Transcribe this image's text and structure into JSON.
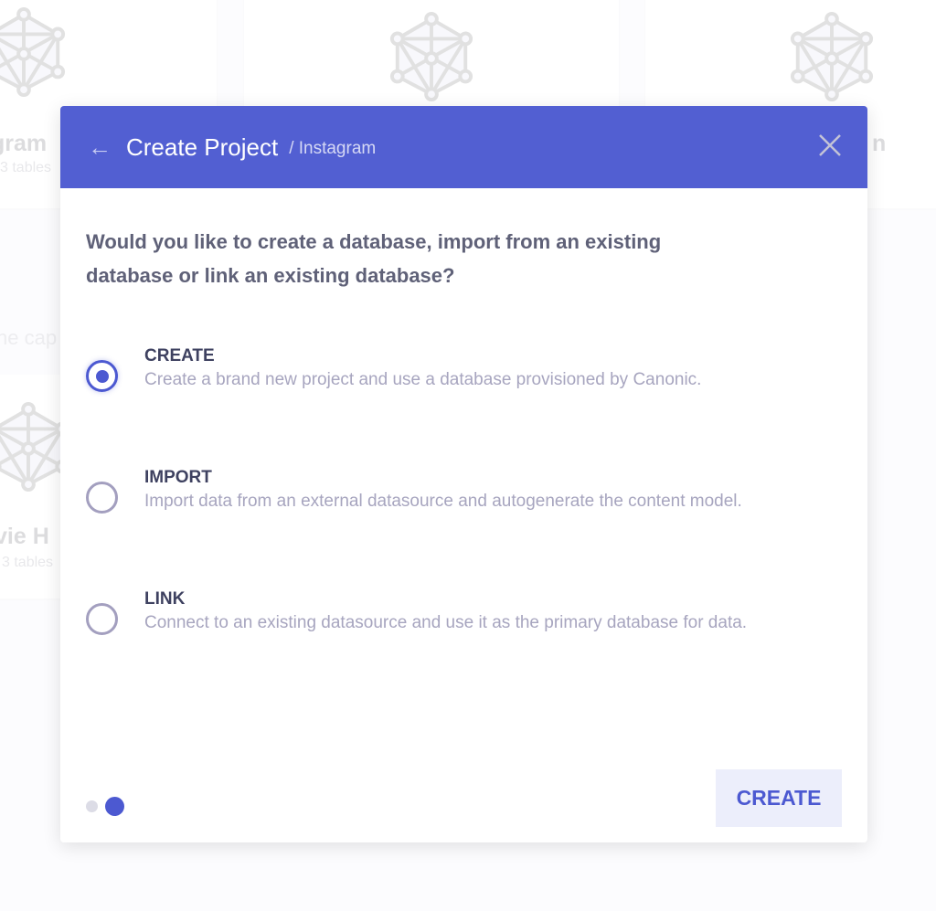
{
  "background": {
    "cards": [
      {
        "title": "gram",
        "subtitle": "3 tables"
      },
      {
        "title": "",
        "subtitle": ""
      },
      {
        "title": "n",
        "subtitle": ""
      },
      {
        "title": "vie H",
        "subtitle": "3 tables"
      }
    ],
    "partial_text": "ne cap"
  },
  "modal": {
    "back_icon": "arrow-left-icon",
    "title": "Create Project",
    "breadcrumb": "/ Instagram",
    "close_icon": "close-x-icon",
    "question": "Would you like to create a database, import from an existing database or link an existing database?",
    "options": [
      {
        "label": "CREATE",
        "description": "Create a brand new project and use a database provisioned by Canonic.",
        "selected": true
      },
      {
        "label": "IMPORT",
        "description": "Import data from an external datasource and autogenerate the content model.",
        "selected": false
      },
      {
        "label": "LINK",
        "description": "Connect to an existing datasource and use it as the primary database for data.",
        "selected": false
      }
    ],
    "step": {
      "current": 2,
      "total": 2
    },
    "submit_label": "CREATE",
    "accent_color": "#525fd2"
  }
}
